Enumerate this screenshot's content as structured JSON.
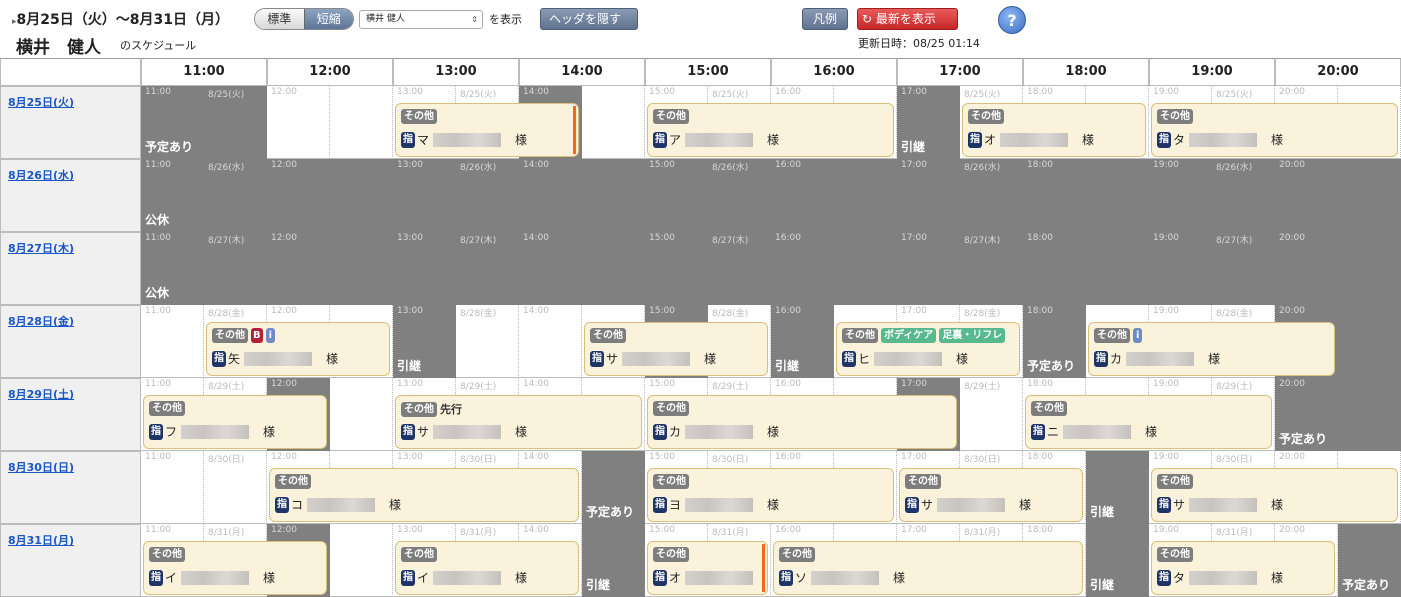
{
  "header": {
    "range": "8月25日（火）〜8月31日（月）",
    "user_name": "横井　健人",
    "user_suffix": "のスケジュール",
    "view_standard": "標準",
    "view_compact": "短縮",
    "staff_select": "横井 健人",
    "show_label": "を表示",
    "hide_header": "ヘッダを隠す",
    "legend": "凡例",
    "refresh": "最新を表示",
    "help": "?",
    "updated": "更新日時：08/25 01:14"
  },
  "hours": [
    "11:00",
    "12:00",
    "13:00",
    "14:00",
    "15:00",
    "16:00",
    "17:00",
    "18:00",
    "19:00",
    "20:00"
  ],
  "days": [
    {
      "label": "8月25日(火)",
      "short": "8/25(火)"
    },
    {
      "label": "8月26日(水)",
      "short": "8/26(水)"
    },
    {
      "label": "8月27日(木)",
      "short": "8/27(木)"
    },
    {
      "label": "8月28日(金)",
      "short": "8/28(金)"
    },
    {
      "label": "8月29日(土)",
      "short": "8/29(土)"
    },
    {
      "label": "8月30日(日)",
      "short": "8/30(日)"
    },
    {
      "label": "8月31日(月)",
      "short": "8/31(月)"
    }
  ],
  "labels": {
    "busy": "予定あり",
    "holiday": "公休",
    "handover": "引継",
    "sono": "その他",
    "shi": "指",
    "sama": "様",
    "senko": "先行",
    "body": "ボディケア",
    "foot": "足裏・リフレ"
  },
  "schedule": [
    {
      "dark": [
        [
          11,
          12
        ],
        [
          14,
          14.5
        ],
        [
          17,
          17.5
        ]
      ],
      "blocks": [
        [
          11,
          "busy"
        ],
        [
          14,
          "busy"
        ],
        [
          17,
          "handover"
        ]
      ],
      "events": [
        [
          13,
          14.5,
          "マ",
          [],
          true
        ],
        [
          15,
          17,
          "ア",
          []
        ],
        [
          17.5,
          19,
          "オ",
          []
        ],
        [
          19,
          21,
          "タ",
          []
        ]
      ]
    },
    {
      "dark": [
        [
          11,
          21
        ]
      ],
      "blocks": [
        [
          11,
          "holiday"
        ]
      ],
      "events": []
    },
    {
      "dark": [
        [
          11,
          21
        ]
      ],
      "blocks": [
        [
          11,
          "holiday"
        ]
      ],
      "events": []
    },
    {
      "dark": [
        [
          13,
          13.5
        ],
        [
          15,
          15.5
        ],
        [
          16,
          16.5
        ],
        [
          18,
          18.5
        ],
        [
          20,
          21
        ]
      ],
      "blocks": [
        [
          13,
          "handover"
        ],
        [
          16,
          "handover"
        ],
        [
          18,
          "busy"
        ],
        [
          20,
          "handover"
        ]
      ],
      "events": [
        [
          11.5,
          13,
          "矢",
          [
            "b",
            "i"
          ]
        ],
        [
          14.5,
          16,
          "サ",
          []
        ],
        [
          16.5,
          18,
          "ヒ",
          [
            "body",
            "foot"
          ]
        ],
        [
          18.5,
          20.5,
          "カ",
          [
            "i"
          ]
        ]
      ]
    },
    {
      "dark": [
        [
          12,
          12.5
        ],
        [
          17,
          17.5
        ],
        [
          20,
          21
        ]
      ],
      "blocks": [
        [
          12,
          "busy"
        ],
        [
          17,
          "handover"
        ],
        [
          20,
          "busy"
        ]
      ],
      "events": [
        [
          11,
          12.5,
          "フ",
          []
        ],
        [
          13,
          15,
          "サ",
          [
            "senko"
          ]
        ],
        [
          15,
          17.5,
          "カ",
          []
        ],
        [
          18,
          20,
          "ニ",
          []
        ]
      ]
    },
    {
      "dark": [
        [
          14.5,
          15
        ],
        [
          18.5,
          19
        ]
      ],
      "blocks": [
        [
          14.5,
          "busy"
        ],
        [
          18.5,
          "handover"
        ]
      ],
      "events": [
        [
          12,
          14.5,
          "コ",
          []
        ],
        [
          15,
          17,
          "ヨ",
          []
        ],
        [
          17,
          18.5,
          "サ",
          []
        ],
        [
          19,
          21,
          "サ",
          []
        ]
      ]
    },
    {
      "dark": [
        [
          12,
          12.5
        ],
        [
          14.5,
          15
        ],
        [
          18.5,
          19
        ],
        [
          20.5,
          21
        ]
      ],
      "blocks": [
        [
          12,
          "handover"
        ],
        [
          14.5,
          "handover"
        ],
        [
          18.5,
          "handover"
        ],
        [
          20.5,
          "busy"
        ]
      ],
      "events": [
        [
          11,
          12.5,
          "イ",
          []
        ],
        [
          13,
          14.5,
          "イ",
          []
        ],
        [
          15,
          16,
          "オ",
          [],
          true
        ],
        [
          16,
          18.5,
          "ソ",
          []
        ],
        [
          19,
          20.5,
          "タ",
          []
        ]
      ]
    }
  ]
}
